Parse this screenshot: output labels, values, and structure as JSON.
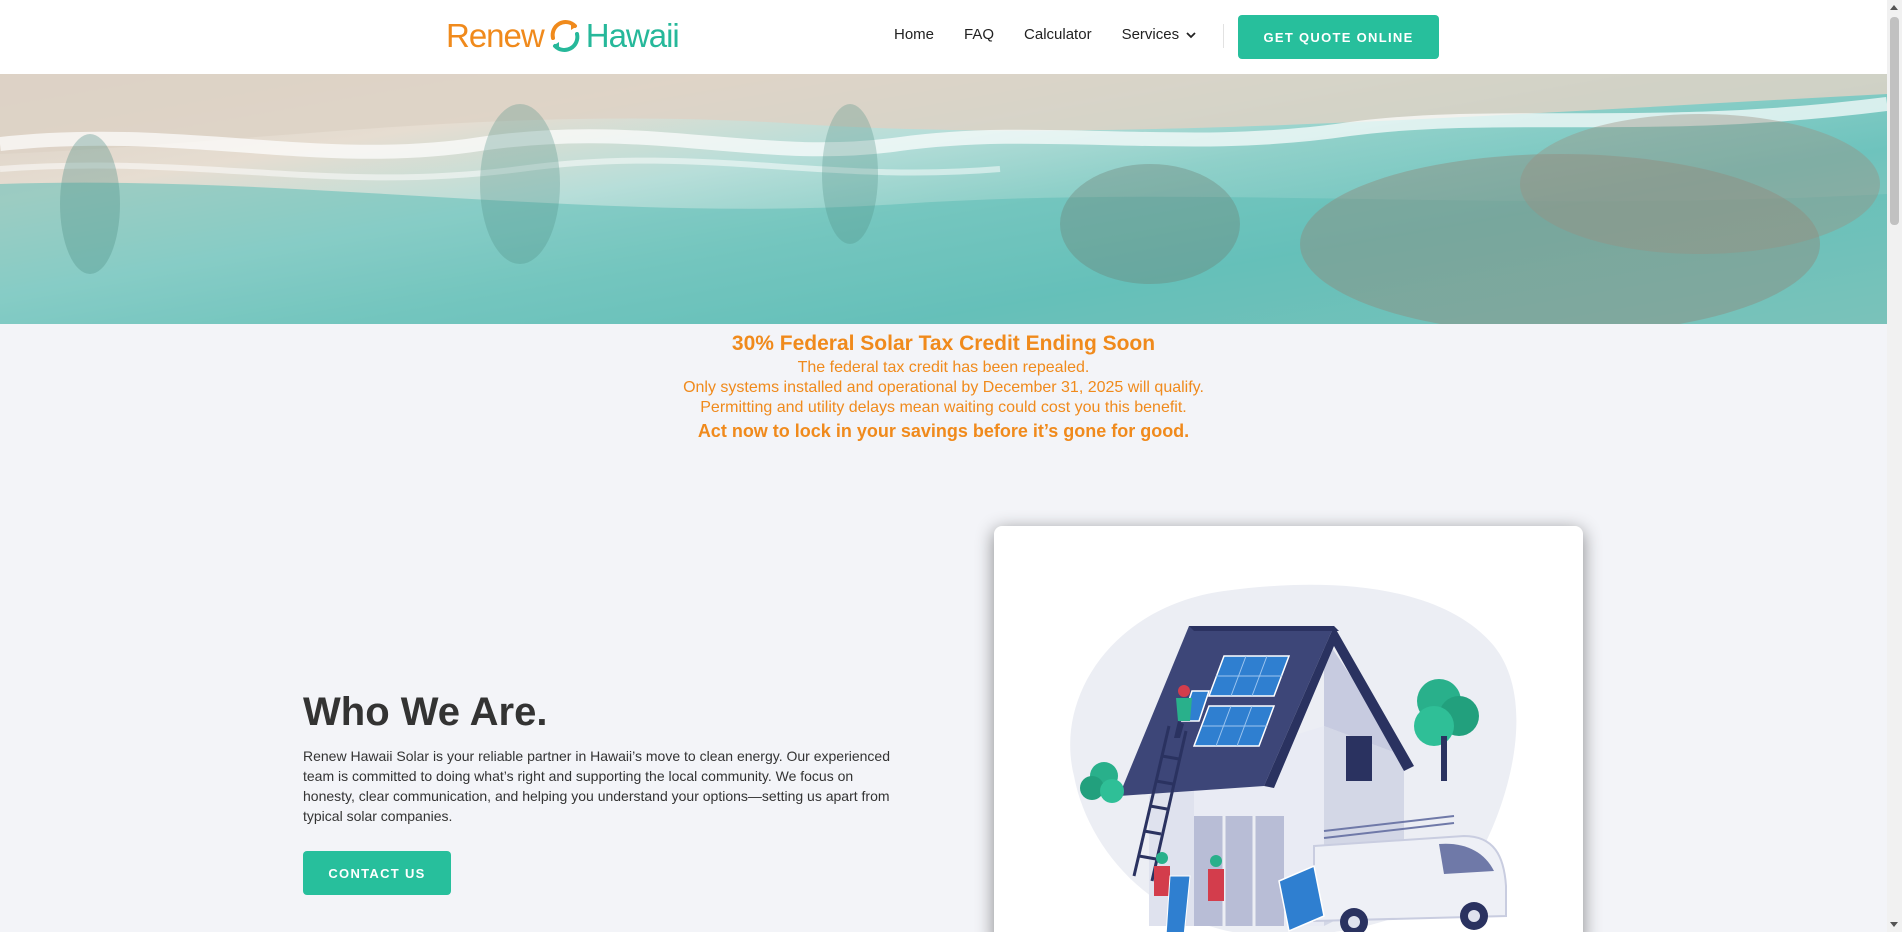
{
  "header": {
    "logo": {
      "part1": "Renew",
      "part2": "Hawaii"
    },
    "nav": [
      {
        "label": "Home"
      },
      {
        "label": "FAQ"
      },
      {
        "label": "Calculator"
      },
      {
        "label": "Services"
      }
    ],
    "quote_button": "GET QUOTE ONLINE"
  },
  "notice": {
    "title": "30% Federal Solar Tax Credit Ending Soon",
    "lines": [
      "The federal tax credit has been repealed.",
      "Only systems installed and operational by December 31, 2025 will qualify.",
      "Permitting and utility delays mean waiting could cost you this benefit."
    ],
    "cta": "Act now to lock in your savings before it’s gone for good."
  },
  "about": {
    "heading": "Who We Are.",
    "body": "Renew Hawaii Solar is your reliable partner in Hawaii’s move to clean energy. Our experienced team is committed to doing what’s right and supporting the local community. We focus on honesty, clear communication, and helping you understand your options—setting us apart from typical solar companies.",
    "button": "CONTACT US"
  },
  "colors": {
    "brand_orange": "#f08a1c",
    "brand_teal": "#27bf9c",
    "page_bg": "#f3f4f8"
  },
  "icons": {
    "nav_dropdown": "chevron-down-icon",
    "logo_mark": "swirl-logo-icon"
  }
}
